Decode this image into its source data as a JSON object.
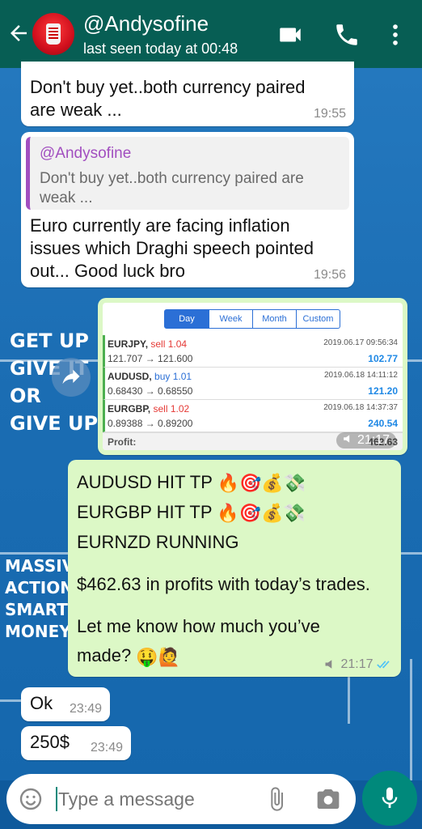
{
  "header": {
    "name": "@Andysofine",
    "status": "last seen today at 00:48"
  },
  "wallpaper": {
    "texts": [
      "GET UP",
      "GIVE IT",
      "OR",
      "GIVE UP",
      "MASSIVE",
      "ACTION",
      "SMART",
      "MONEY"
    ]
  },
  "messages": {
    "m1": {
      "text_line1": "Don't buy yet..both currency paired",
      "text_line2": "are weak ...",
      "time": "19:55"
    },
    "m2": {
      "quote_author": "@Andysofine",
      "quote_line1": "Don't buy yet..both currency paired are",
      "quote_line2": "weak ...",
      "line1": "Euro currently are facing inflation",
      "line2": "issues which Draghi speech pointed",
      "line3": "out... Good luck bro",
      "time": "19:56"
    },
    "image": {
      "tabs": [
        "Day",
        "Week",
        "Month",
        "Custom"
      ],
      "active_tab": "Day",
      "trades": [
        {
          "pair": "EURJPY,",
          "side": "sell 1.04",
          "date": "2019.06.17 09:56:34",
          "prices": "121.707 → 121.600",
          "profit": "102.77"
        },
        {
          "pair": "AUDUSD,",
          "side": "buy 1.01",
          "date": "2019.06.18 14:11:12",
          "prices": "0.68430 → 0.68550",
          "profit": "121.20"
        },
        {
          "pair": "EURGBP,",
          "side": "sell 1.02",
          "date": "2019.06.18 14:37:37",
          "prices": "0.89388 → 0.89200",
          "profit": "240.54"
        }
      ],
      "profit_label": "Profit:",
      "profit_total": "462.63",
      "time": "21:17"
    },
    "m3": {
      "line1": "AUDUSD HIT TP",
      "line2": "EURGBP HIT TP",
      "line3": "EURNZD RUNNING",
      "line4": "$462.63 in profits with today’s trades.",
      "line5": "Let me know how much you’ve",
      "line6": "made?",
      "time": "21:17"
    },
    "m4": {
      "text": "Ok",
      "time": "23:49"
    },
    "m5": {
      "text": "250$",
      "time": "23:49"
    }
  },
  "composer": {
    "placeholder": "Type a message"
  },
  "colors": {
    "header": "#075e54",
    "outgoing": "#dcf8c6",
    "incoming": "#ffffff",
    "accent": "#00897b",
    "read_ticks": "#4fc3f7"
  },
  "icons": [
    "back-arrow-icon",
    "video-call-icon",
    "phone-icon",
    "more-vert-icon",
    "forward-icon",
    "emoji-icon",
    "attach-icon",
    "camera-icon",
    "mic-icon",
    "double-check-icon",
    "speaker-icon"
  ]
}
